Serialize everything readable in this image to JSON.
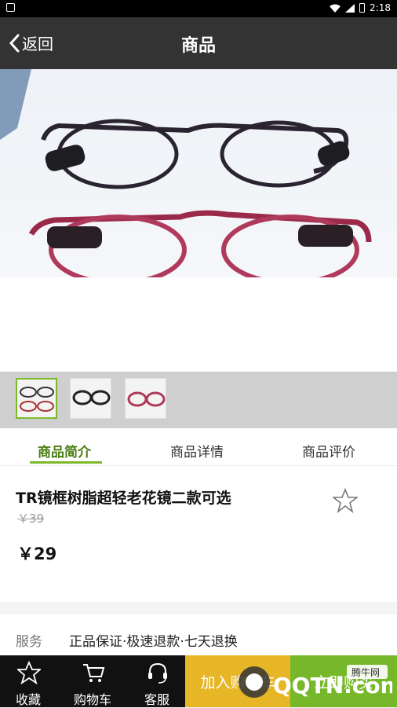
{
  "status_bar": {
    "time": "2:18"
  },
  "header": {
    "back_label": "返回",
    "title": "商品"
  },
  "tabs": [
    {
      "label": "商品简介",
      "active": true
    },
    {
      "label": "商品详情",
      "active": false
    },
    {
      "label": "商品评价",
      "active": false
    }
  ],
  "product": {
    "name": "TR镜框树脂超轻老花镜二款可选",
    "original_price": "￥39",
    "price": "￥29"
  },
  "service": {
    "label": "服务",
    "text": "正品保证·极速退款·七天退换"
  },
  "bottom_nav": [
    {
      "label": "收藏",
      "icon": "star-icon"
    },
    {
      "label": "购物车",
      "icon": "cart-icon"
    },
    {
      "label": "客服",
      "icon": "headset-icon"
    }
  ],
  "actions": {
    "add_to_cart": "加入购物车",
    "buy_now": "立即购买"
  },
  "watermark": {
    "text": "QQTN.com",
    "badge": "腾牛网"
  },
  "colors": {
    "header_bg": "#333333",
    "accent_green": "#76b82a",
    "add_cart_yellow": "#e6b627"
  }
}
